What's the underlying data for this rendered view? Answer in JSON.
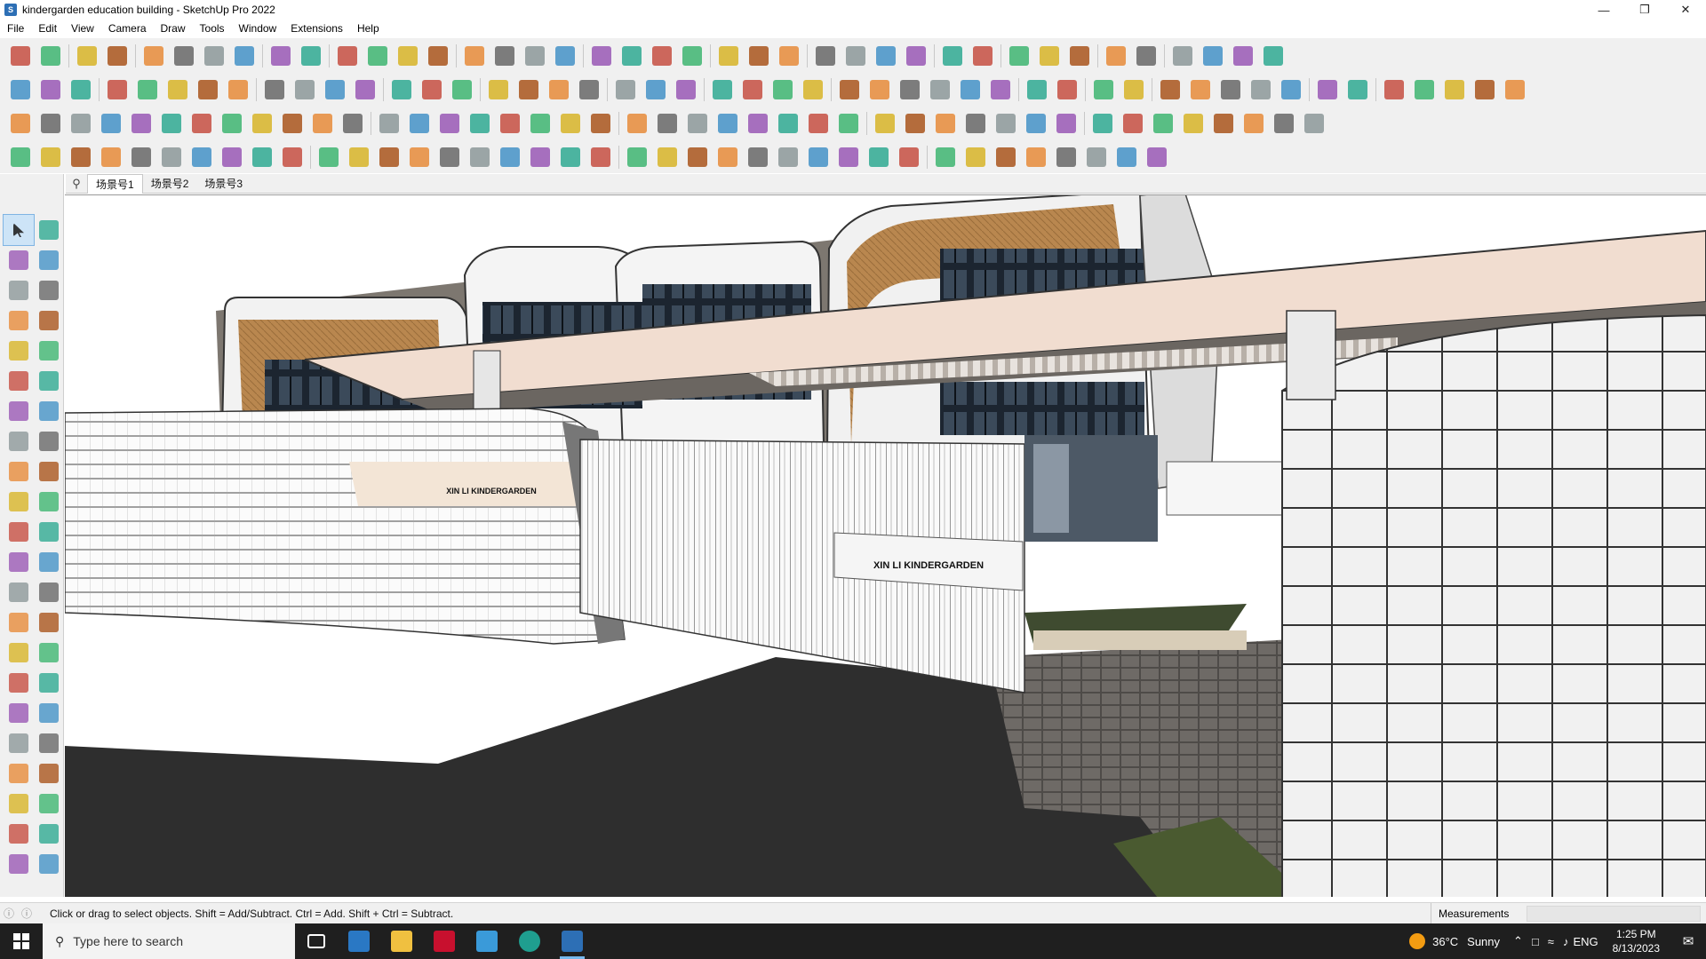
{
  "window": {
    "title": "kindergarden education building - SketchUp Pro 2022",
    "controls": [
      "minimize",
      "restore",
      "close"
    ]
  },
  "menu": [
    "File",
    "Edit",
    "View",
    "Camera",
    "Draw",
    "Tools",
    "Window",
    "Extensions",
    "Help"
  ],
  "toolbar_colors": [
    "#c0392b",
    "#2e86c1",
    "#e67e22",
    "#27ae60",
    "#8e44ad",
    "#555555",
    "#d4ac0d",
    "#16a085",
    "#7f8c8d",
    "#a04000"
  ],
  "scenes": {
    "tabs": [
      "场景号1",
      "场景号2",
      "场景号3"
    ],
    "active": "场景号1"
  },
  "viewport": {
    "signs": {
      "wall_sign": "XIN LI KINDERGARDEN",
      "gate_sign": "XIN LI KINDERGARDEN"
    }
  },
  "status": {
    "hint": "Click or drag to select objects. Shift = Add/Subtract. Ctrl = Add. Shift + Ctrl = Subtract.",
    "measurements_label": "Measurements",
    "measurements_value": ""
  },
  "taskbar": {
    "search_placeholder": "Type here to search",
    "apps": [
      "task-view",
      "calculator",
      "file-explorer",
      "acrobat",
      "teams",
      "edge",
      "sketchup"
    ],
    "weather_temp": "36°C",
    "weather_cond": "Sunny",
    "language": "ENG",
    "time": "1:25 PM",
    "date": "8/13/2023"
  }
}
